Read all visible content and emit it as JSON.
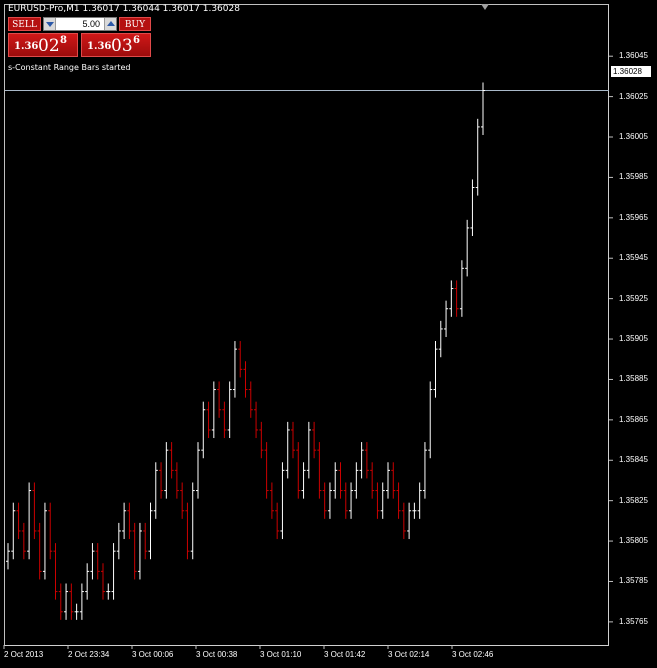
{
  "window": {
    "symbol_line": "EURUSD-Pro,M1  1.36017 1.36044 1.36017 1.36028",
    "status": "s-Constant Range Bars started"
  },
  "trade_panel": {
    "sell_label": "SELL",
    "buy_label": "BUY",
    "lot_value": "5.00",
    "sell_quote": {
      "prefix": "1.36",
      "big": "02",
      "sup": "8"
    },
    "buy_quote": {
      "prefix": "1.36",
      "big": "03",
      "sup": "6"
    }
  },
  "price_axis": {
    "ticks": [
      "1.36045",
      "1.36025",
      "1.36005",
      "1.35985",
      "1.35965",
      "1.35945",
      "1.35925",
      "1.35905",
      "1.35885",
      "1.35865",
      "1.35845",
      "1.35825",
      "1.35805",
      "1.35785",
      "1.35765"
    ],
    "current_price": "1.36028"
  },
  "time_axis": {
    "labels": [
      "2 Oct 2013",
      "2 Oct 23:34",
      "3 Oct 00:06",
      "3 Oct 00:38",
      "3 Oct 01:10",
      "3 Oct 01:42",
      "3 Oct 02:14",
      "3 Oct 02:46"
    ]
  },
  "colors": {
    "background": "#000000",
    "bull": "#ffffff",
    "bear": "#cc0000",
    "grid_line": "#a9b9c9",
    "panel_red": "#b51010"
  },
  "chart_data": {
    "type": "bar",
    "ylim": [
      1.35759,
      1.36055
    ],
    "price_line": 1.36028,
    "series": [
      {
        "values": [
          1.358,
          1.3582,
          1.3581,
          1.358,
          1.3583,
          1.3581,
          1.3579,
          1.3582,
          1.358,
          1.3578,
          1.3577,
          1.3578,
          1.3577,
          1.3577,
          1.3578,
          1.3579,
          1.358,
          1.3579,
          1.3578,
          1.3578,
          1.358,
          1.3581,
          1.3582,
          1.3581,
          1.3579,
          1.3581,
          1.358,
          1.3582,
          1.3584,
          1.3583,
          1.3585,
          1.3584,
          1.3583,
          1.3582,
          1.358,
          1.3583,
          1.3585,
          1.3587,
          1.3586,
          1.3588,
          1.3587,
          1.3586,
          1.3588,
          1.359,
          1.3589,
          1.3588,
          1.3587,
          1.3586,
          1.3585,
          1.3583,
          1.3582,
          1.3581,
          1.3584,
          1.3586,
          1.3585,
          1.3583,
          1.3584,
          1.3586,
          1.3585,
          1.3583,
          1.3582,
          1.3583,
          1.3584,
          1.3583,
          1.3582,
          1.3583,
          1.3584,
          1.3585,
          1.3584,
          1.3583,
          1.3582,
          1.3583,
          1.3584,
          1.3583,
          1.3582,
          1.3581,
          1.3582,
          1.3582,
          1.3583,
          1.3585,
          1.3588,
          1.359,
          1.3591,
          1.3592,
          1.3593,
          1.3592,
          1.3594,
          1.3596,
          1.3598,
          1.3601,
          1.36028
        ]
      }
    ]
  }
}
